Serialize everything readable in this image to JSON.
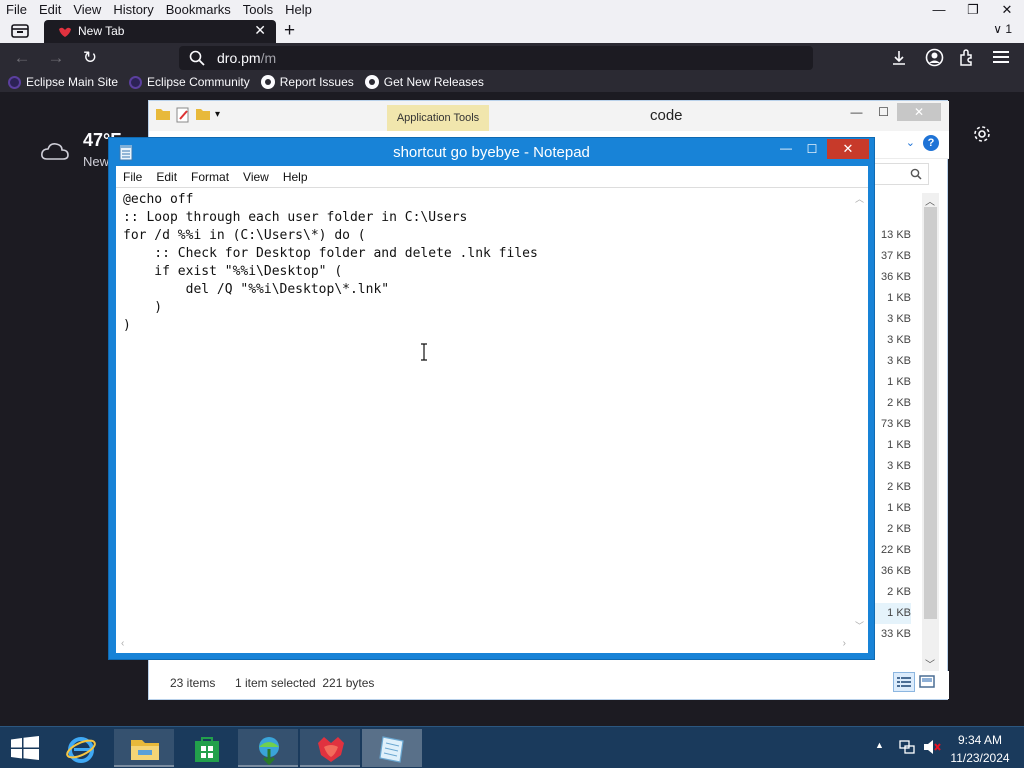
{
  "browser": {
    "menu": [
      "File",
      "Edit",
      "View",
      "History",
      "Bookmarks",
      "Tools",
      "Help"
    ],
    "window_controls": {
      "minimize": "—",
      "restore": "❐",
      "close": "✕"
    },
    "tab": {
      "title": "New Tab",
      "close": "✕"
    },
    "new_tab": "+",
    "tabs_menu": "∨ 1",
    "url": {
      "host": "dro.pm",
      "path": "/m"
    },
    "bookmarks": [
      "Eclipse Main Site",
      "Eclipse Community",
      "Report Issues",
      "Get New Releases"
    ],
    "weather": {
      "temp": "47°F",
      "location": "New"
    }
  },
  "explorer": {
    "context_tab": "Application Tools",
    "title": "code",
    "controls": {
      "minimize": "—",
      "maximize": "☐",
      "close": "✕"
    },
    "help": "?",
    "file_sizes": [
      "13 KB",
      "37 KB",
      "36 KB",
      "1 KB",
      "3 KB",
      "3 KB",
      "3 KB",
      "1 KB",
      "2 KB",
      "73 KB",
      "1 KB",
      "3 KB",
      "2 KB",
      "1 KB",
      "2 KB",
      "22 KB",
      "36 KB",
      "2 KB",
      "1 KB",
      "33 KB"
    ],
    "selected_size_index": 18,
    "status": {
      "items": "23 items",
      "selection": "1 item selected  221 bytes"
    }
  },
  "notepad": {
    "title": "shortcut go byebye - Notepad",
    "controls": {
      "minimize": "—",
      "maximize": "☐",
      "close": "✕"
    },
    "menu": [
      "File",
      "Edit",
      "Format",
      "View",
      "Help"
    ],
    "content": "@echo off\n:: Loop through each user folder in C:\\Users\nfor /d %%i in (C:\\Users\\*) do (\n    :: Check for Desktop folder and delete .lnk files\n    if exist \"%%i\\Desktop\" (\n        del /Q \"%%i\\Desktop\\*.lnk\"\n    )\n)"
  },
  "taskbar": {
    "clock": {
      "time": "9:34 AM",
      "date": "11/23/2024"
    },
    "apps": [
      "Internet Explorer",
      "File Explorer",
      "Store",
      "Internet Download Manager",
      "Firefox",
      "Notepad"
    ]
  }
}
